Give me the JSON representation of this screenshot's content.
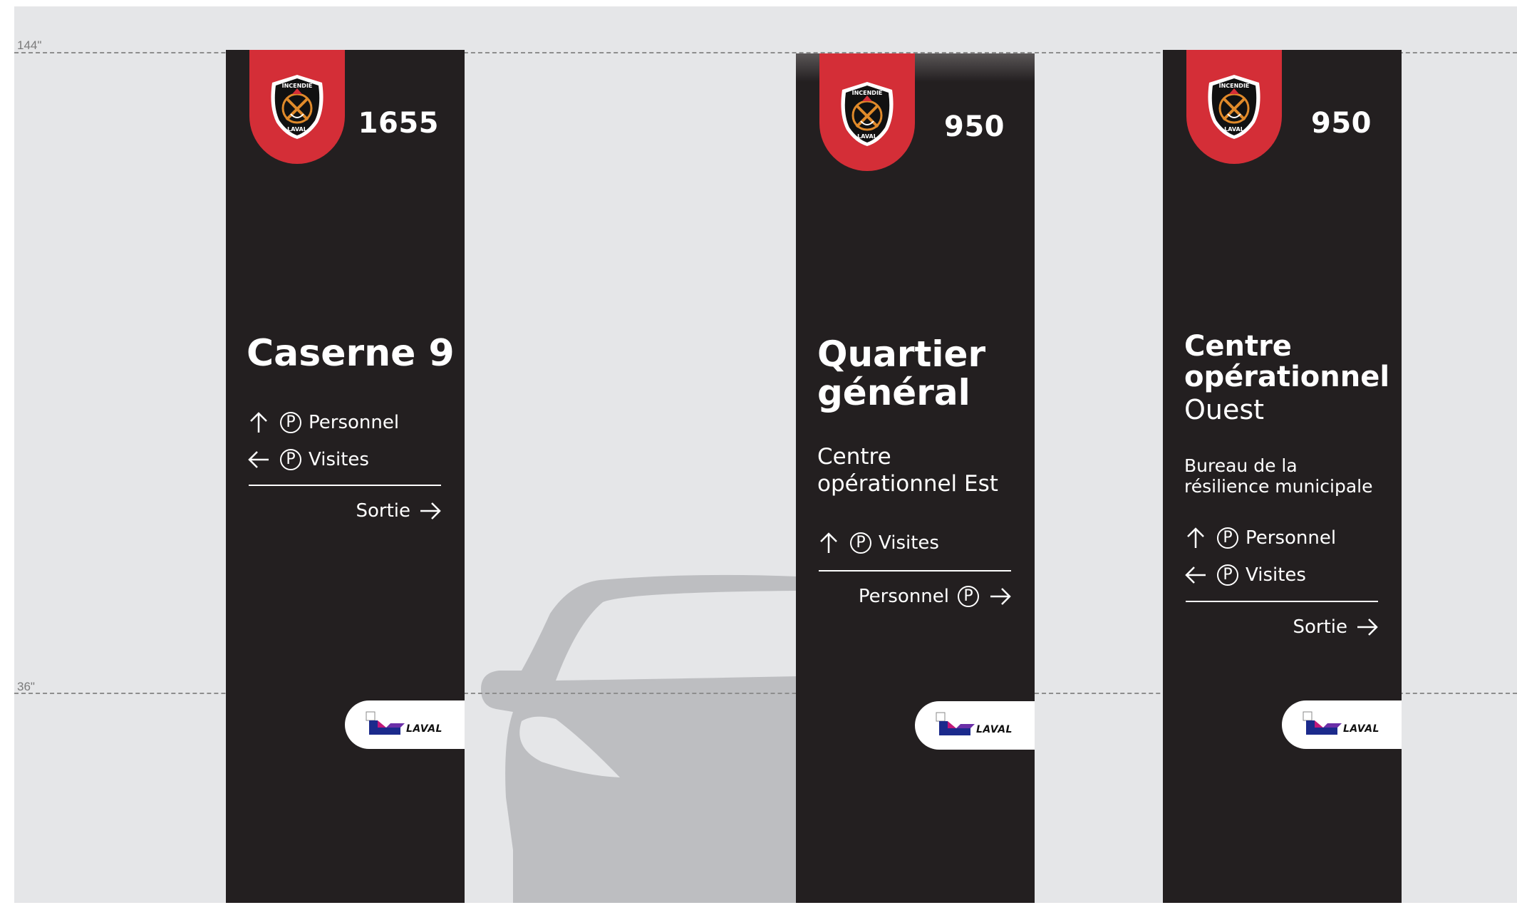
{
  "guides": [
    {
      "label": "144\""
    },
    {
      "label": "36\""
    }
  ],
  "colors": {
    "background": "#e5e6e8",
    "pylon": "#231f20",
    "accent_red": "#d42e37",
    "text": "#ffffff",
    "car_silhouette": "#bdbec1"
  },
  "emblem": {
    "top_text": "INCENDIE",
    "bottom_text": "LAVAL",
    "icon": "fire-helmet-crest-icon"
  },
  "logo": {
    "wordmark": "LAVAL",
    "icon": "laval-l-mark-icon"
  },
  "pylons": [
    {
      "number": "1655",
      "title": "Caserne 9",
      "directions": [
        {
          "arrow": "arrow-up-icon",
          "label": "Personnel"
        },
        {
          "arrow": "arrow-left-icon",
          "label": "Visites"
        }
      ],
      "exit": {
        "label": "Sortie",
        "arrow": "arrow-right-icon"
      }
    },
    {
      "number": "950",
      "title_line1": "Quartier",
      "title_line2": "général",
      "subtitle_line1": "Centre",
      "subtitle_line2": "opérationnel Est",
      "directions": [
        {
          "arrow": "arrow-up-icon",
          "label": "Visites"
        }
      ],
      "exit": {
        "label": "Personnel",
        "arrow": "arrow-right-icon"
      }
    },
    {
      "number": "950",
      "title_line1": "Centre",
      "title_line2": "opérationnel",
      "title_line3": "Ouest",
      "subtitle_line1": "Bureau de la",
      "subtitle_line2": "résilience municipale",
      "directions": [
        {
          "arrow": "arrow-up-icon",
          "label": "Personnel"
        },
        {
          "arrow": "arrow-left-icon",
          "label": "Visites"
        }
      ],
      "exit": {
        "label": "Sortie",
        "arrow": "arrow-right-icon"
      }
    }
  ]
}
